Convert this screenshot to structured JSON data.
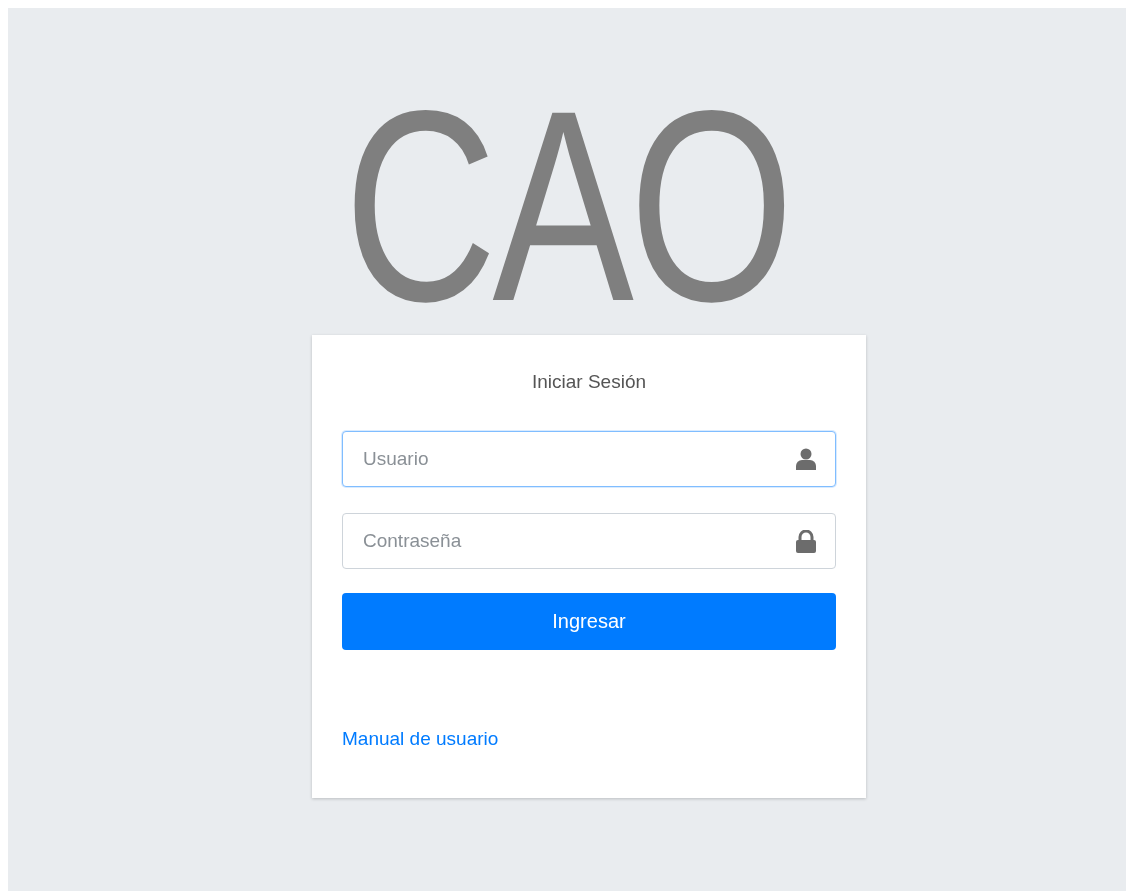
{
  "logo": {
    "text": "CAO"
  },
  "login": {
    "title": "Iniciar Sesión",
    "fields": [
      {
        "placeholder": "Usuario",
        "kind": "username",
        "focused": true
      },
      {
        "placeholder": "Contraseña",
        "kind": "password",
        "focused": false
      }
    ],
    "button": "Ingresar",
    "link": "Manual de usuario"
  }
}
